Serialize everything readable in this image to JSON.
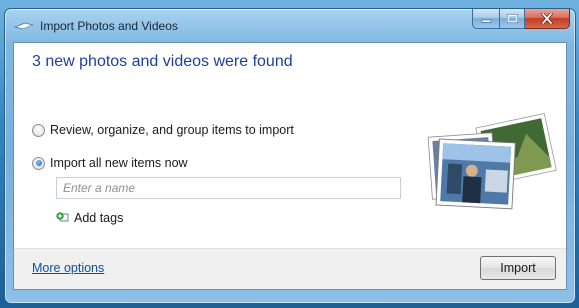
{
  "window": {
    "title": "Import Photos and Videos",
    "buttons": {
      "minimize": "–",
      "maximize": "□",
      "close": "X"
    }
  },
  "main": {
    "heading": "3 new photos and videos were found",
    "options": [
      {
        "label": "Review, organize, and group items to import",
        "selected": false
      },
      {
        "label": "Import all new items now",
        "selected": true
      }
    ],
    "name_input": {
      "placeholder": "Enter a name",
      "value": ""
    },
    "add_tags_label": "Add tags"
  },
  "footer": {
    "more_options_link": "More options",
    "import_button": "Import"
  },
  "icons": {
    "title": "camera-import-icon",
    "tags": "tag-add-icon",
    "preview": "photo-stack-icon"
  },
  "colors": {
    "heading": "#1e3fa0",
    "link": "#0b4fa3",
    "titlebar": "#7fb7e2",
    "close_button": "#c23b22"
  }
}
